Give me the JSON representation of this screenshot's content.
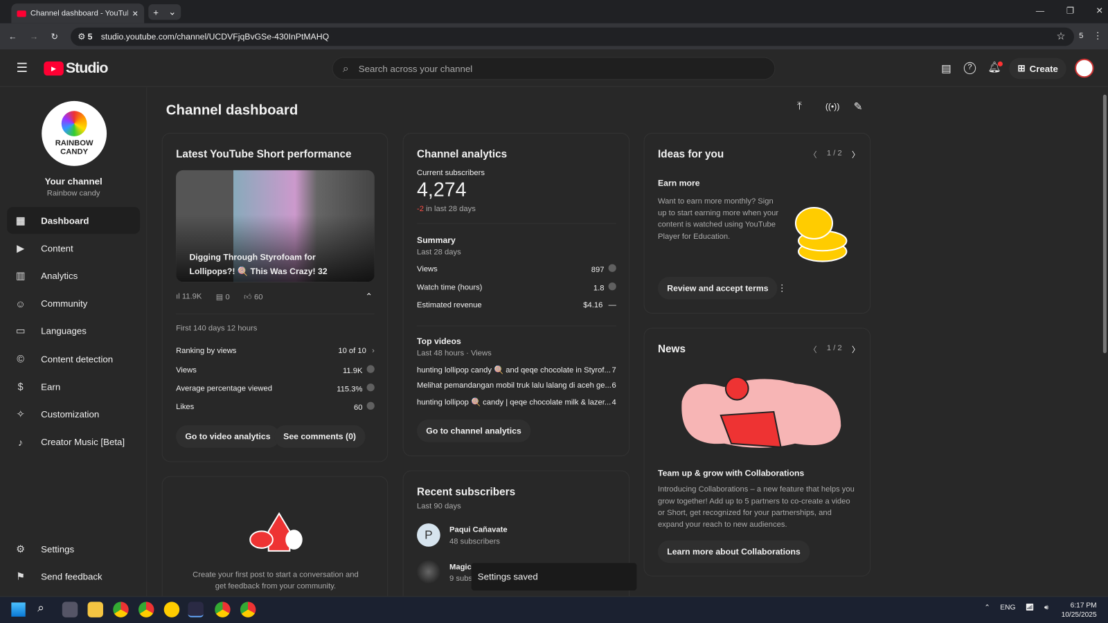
{
  "browser": {
    "tab_title": "Channel dashboard - YouTube Studio",
    "url": "studio.youtube.com/channel/UCDVFjqBvGSe-430InPtMAHQ",
    "site_badge": "5",
    "ext_count": "5"
  },
  "header": {
    "logo": "Studio",
    "search_placeholder": "Search across your channel",
    "create_label": "Create"
  },
  "channel": {
    "avatar_text": "RAINBOW CANDY",
    "label": "Your channel",
    "name": "Rainbow candy"
  },
  "sidebar": {
    "items": [
      {
        "label": "Dashboard",
        "icon": "dashboard-icon"
      },
      {
        "label": "Content",
        "icon": "content-icon"
      },
      {
        "label": "Analytics",
        "icon": "analytics-icon"
      },
      {
        "label": "Community",
        "icon": "community-icon"
      },
      {
        "label": "Languages",
        "icon": "languages-icon"
      },
      {
        "label": "Content detection",
        "icon": "copyright-icon"
      },
      {
        "label": "Earn",
        "icon": "dollar-icon"
      },
      {
        "label": "Customization",
        "icon": "wand-icon"
      },
      {
        "label": "Creator Music [Beta]",
        "icon": "music-icon"
      }
    ],
    "settings": "Settings",
    "feedback": "Send feedback"
  },
  "page_title": "Channel dashboard",
  "short": {
    "title": "Latest YouTube Short performance",
    "video_title": "Digging Through Styrofoam for Lollipops?! 🍭 This Was Crazy! 32",
    "views": "11.9K",
    "comments": "0",
    "likes": "60",
    "period": "First 140 days 12 hours",
    "stats": [
      {
        "label": "Ranking by views",
        "value": "10 of 10"
      },
      {
        "label": "Views",
        "value": "11.9K"
      },
      {
        "label": "Average percentage viewed",
        "value": "115.3%"
      },
      {
        "label": "Likes",
        "value": "60"
      }
    ],
    "btn_analytics": "Go to video analytics",
    "btn_comments": "See comments (0)"
  },
  "community": {
    "text": "Create your first post to start a conversation and get feedback from your community."
  },
  "analytics": {
    "title": "Channel analytics",
    "subs_label": "Current subscribers",
    "subs": "4,274",
    "change": "-2",
    "change_suffix": " in last 28 days",
    "summary": "Summary",
    "summary_period": "Last 28 days",
    "rows": [
      {
        "label": "Views",
        "value": "897"
      },
      {
        "label": "Watch time (hours)",
        "value": "1.8"
      },
      {
        "label": "Estimated revenue",
        "value": "$4.16"
      }
    ],
    "top": "Top videos",
    "top_period": "Last 48 hours · Views",
    "videos": [
      {
        "title": "hunting lollipop candy 🍭 and qeqe chocolate in Styrof...",
        "views": "7"
      },
      {
        "title": "Melihat pemandangan mobil truk lalu lalang di aceh ge...",
        "views": "6"
      },
      {
        "title": "hunting lollipop 🍭 candy | qeqe chocolate milk & lazer...",
        "views": "4"
      }
    ],
    "button": "Go to channel analytics"
  },
  "subscribers": {
    "title": "Recent subscribers",
    "period": "Last 90 days",
    "list": [
      {
        "initial": "P",
        "name": "Paqui Cañavate",
        "count": "48 subscribers"
      },
      {
        "initial": "",
        "name": "Magic",
        "count": "9 subs"
      }
    ]
  },
  "ideas": {
    "title": "Ideas for you",
    "pager": "1 / 2",
    "heading": "Earn more",
    "body": "Want to earn more monthly? Sign up to start earning more when your content is watched using YouTube Player for Education.",
    "button": "Review and accept terms"
  },
  "news": {
    "title": "News",
    "pager": "1 / 2",
    "heading": "Team up & grow with Collaborations",
    "body": "Introducing Collaborations – a new feature that helps you grow together! Add up to 5 partners to co-create a video or Short, get recognized for your partnerships, and expand your reach to new audiences.",
    "button": "Learn more about Collaborations"
  },
  "toast": "Settings saved",
  "taskbar": {
    "lang": "ENG",
    "time": "6:17 PM",
    "date": "10/25/2025"
  }
}
